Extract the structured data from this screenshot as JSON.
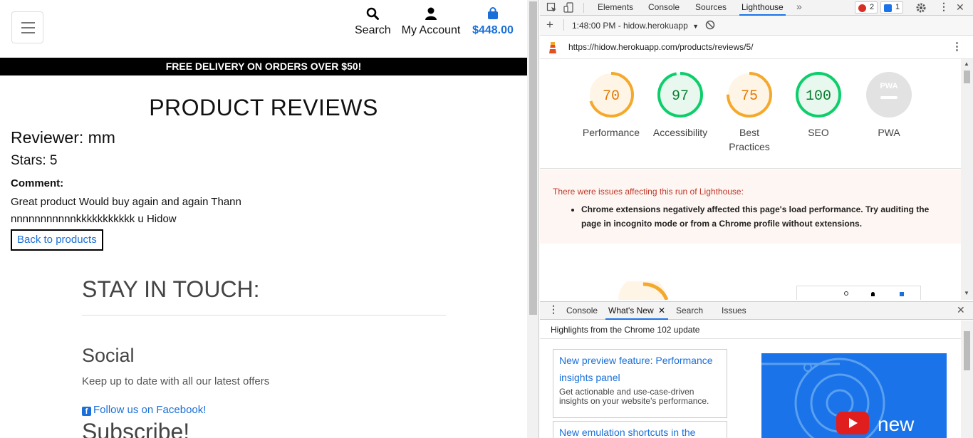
{
  "site": {
    "nav": {
      "search_label": "Search",
      "account_label": "My Account",
      "bag_total": "$448.00"
    },
    "banner": "FREE DELIVERY ON ORDERS OVER $50!",
    "title": "PRODUCT REVIEWS",
    "review": {
      "reviewer": "Reviewer: mm",
      "stars": "Stars: 5",
      "comment_label": "Comment:",
      "comment": "Great product Would buy again and again Thannnnnnnnnnnnnkkkkkkkkkkk u Hidow"
    },
    "back_button": "Back to products",
    "footer": {
      "stay_title": "STAY IN TOUCH:",
      "social_title": "Social",
      "social_desc": "Keep up to date with all our latest offers",
      "facebook_link": "Follow us on Facebook!",
      "subscribe_title": "Subscribe!"
    }
  },
  "devtools": {
    "tabs": [
      "Elements",
      "Console",
      "Sources",
      "Lighthouse"
    ],
    "active_tab": "Lighthouse",
    "error_count": "2",
    "message_count": "1",
    "run_time": "1:48:00 PM - hidow.herokuapp",
    "report_url": "https://hidow.herokuapp.com/products/reviews/5/",
    "scores": [
      {
        "value": "70",
        "label": "Performance",
        "color": "#e67700",
        "ring": "#f4a92c",
        "bg": "#fff5e6"
      },
      {
        "value": "97",
        "label": "Accessibility",
        "color": "#0a7d32",
        "ring": "#0cce6b",
        "bg": "#e8f8ee"
      },
      {
        "value": "75",
        "label": "Best Practices",
        "color": "#e67700",
        "ring": "#f4a92c",
        "bg": "#fff5e6"
      },
      {
        "value": "100",
        "label": "SEO",
        "color": "#0a7d32",
        "ring": "#0cce6b",
        "bg": "#e8f8ee"
      }
    ],
    "pwa_label": "PWA",
    "pwa_badge": "PWA",
    "issues_heading": "There were issues affecting this run of Lighthouse:",
    "issues_item": "Chrome extensions negatively affected this page's load performance. Try auditing the page in incognito mode or from a Chrome profile without extensions.",
    "drawer_tabs": [
      "Console",
      "What's New",
      "Search",
      "Issues"
    ],
    "drawer_active": "What's New",
    "highlights": "Highlights from the Chrome 102 update",
    "cards": [
      {
        "title": "New preview feature: Performance insights panel",
        "desc": "Get actionable and use-case-driven insights on your website's performance."
      },
      {
        "title": "New emulation shortcuts in the",
        "desc": ""
      }
    ],
    "video_text": "new"
  },
  "colors": {
    "accent": "#1a6fd8",
    "devtools_blue": "#1a73e8",
    "banner_bg": "#000000"
  }
}
